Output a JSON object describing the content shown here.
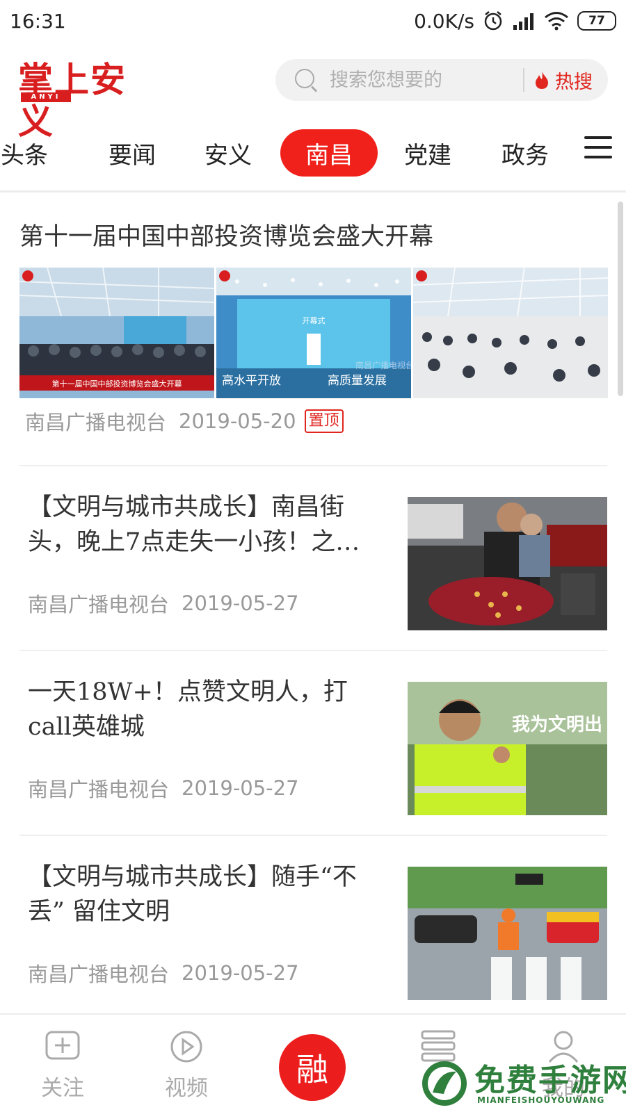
{
  "status_bar": {
    "time": "16:31",
    "network_speed": "0.0K/s",
    "battery": "77",
    "icons": [
      "alarm-icon",
      "signal-icon",
      "wifi-icon",
      "battery-icon"
    ]
  },
  "header": {
    "logo_text": "掌上安义",
    "logo_sub": "ANYI",
    "search_placeholder": "搜索您想要的",
    "hot_search_label": "热搜"
  },
  "tabs": [
    {
      "label": "头条"
    },
    {
      "label": "要闻"
    },
    {
      "label": "安义"
    },
    {
      "label": "南昌",
      "active": true
    },
    {
      "label": "党建"
    },
    {
      "label": "政务"
    }
  ],
  "feed": {
    "top_article": {
      "title": "第十一届中国中部投资博览会盛大开幕",
      "source": "南昌广播电视台",
      "date": "2019-05-20",
      "badge": "置顶",
      "image_captions": [
        "第十一届中国中部投资博览会盛大开幕",
        "高水平开放",
        "高质量发展",
        "南昌广播电视台",
        "开幕式"
      ]
    },
    "items": [
      {
        "title": "【文明与城市共成长】南昌街头，晚上7点走失一小孩！之…",
        "source": "南昌广播电视台",
        "date": "2019-05-27"
      },
      {
        "title": "一天18W+！点赞文明人，打call英雄城",
        "source": "南昌广播电视台",
        "date": "2019-05-27",
        "image_text": "我为文明出"
      },
      {
        "title": "【文明与城市共成长】随手“不丢” 留住文明",
        "source": "南昌广播电视台",
        "date": "2019-05-27"
      }
    ]
  },
  "bottom_nav": {
    "follow": "关注",
    "video": "视频",
    "center": "融",
    "service": "服",
    "mine": "我的"
  },
  "watermark": {
    "text": "免费手游网",
    "sub": "MIANFEISHOUYOUWANG"
  },
  "colors": {
    "accent": "#f0201b",
    "text": "#333333",
    "meta": "#999999",
    "watermark": "#2f7f3d"
  }
}
